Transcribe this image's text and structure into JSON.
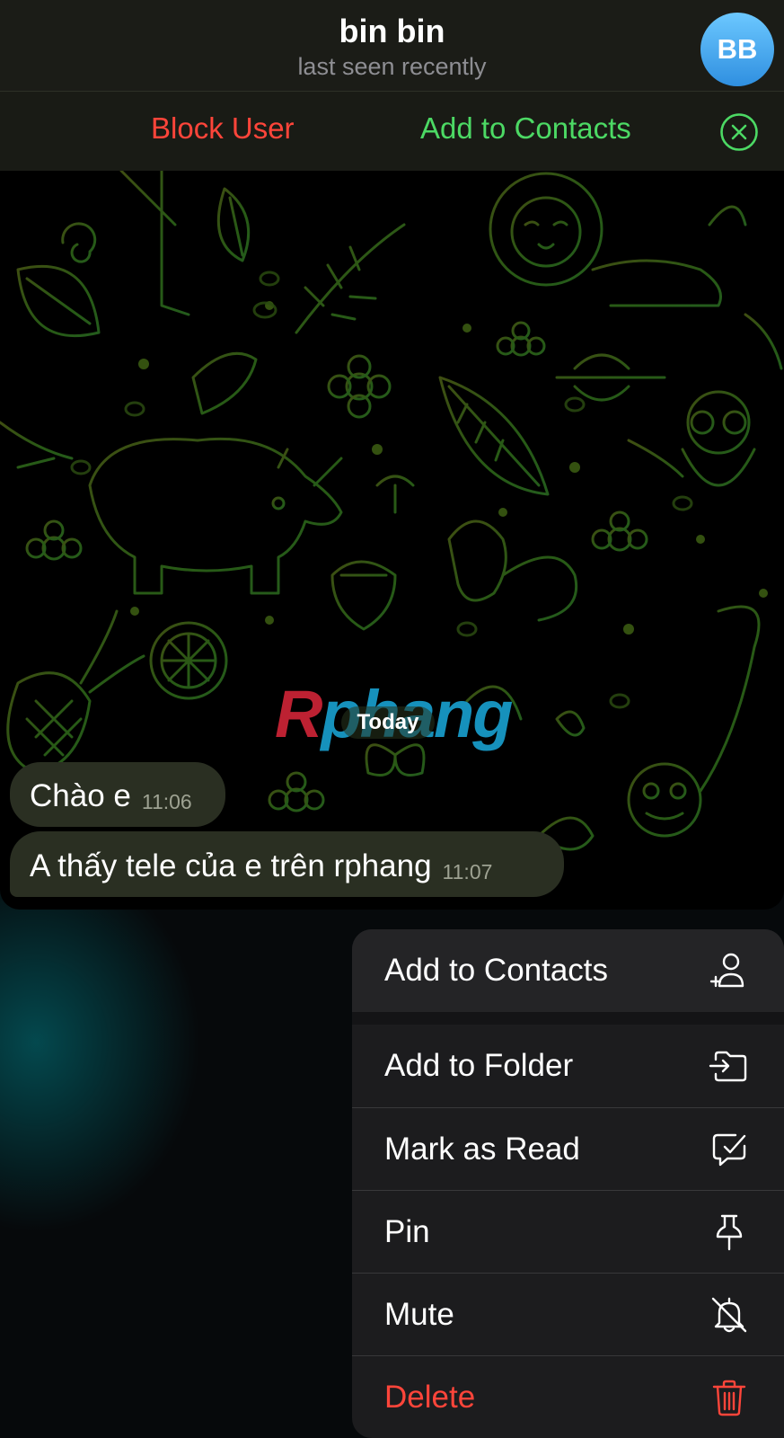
{
  "header": {
    "title": "bin bin",
    "status": "last seen recently",
    "avatar_initials": "BB"
  },
  "action_bar": {
    "block_label": "Block User",
    "add_contact_label": "Add to Contacts",
    "close_icon": "close-circle-icon"
  },
  "chat": {
    "date_separator": "Today",
    "watermark": {
      "first": "R",
      "rest": "phang"
    },
    "messages": [
      {
        "text": "Chào e",
        "time": "11:06"
      },
      {
        "text": "A thấy tele của e trên rphang",
        "time": "11:07"
      }
    ]
  },
  "menu": {
    "items": [
      {
        "label": "Add to Contacts",
        "icon": "add-contact-icon"
      },
      {
        "label": "Add to Folder",
        "icon": "move-to-folder-icon"
      },
      {
        "label": "Mark as Read",
        "icon": "mark-read-icon"
      },
      {
        "label": "Pin",
        "icon": "pin-icon"
      },
      {
        "label": "Mute",
        "icon": "bell-slash-icon"
      },
      {
        "label": "Delete",
        "icon": "trash-icon"
      }
    ]
  },
  "colors": {
    "danger": "#ff453a",
    "accent_green": "#4cd964",
    "wallpaper_line": "#2e6b1f",
    "avatar": "#3a9cf0"
  }
}
